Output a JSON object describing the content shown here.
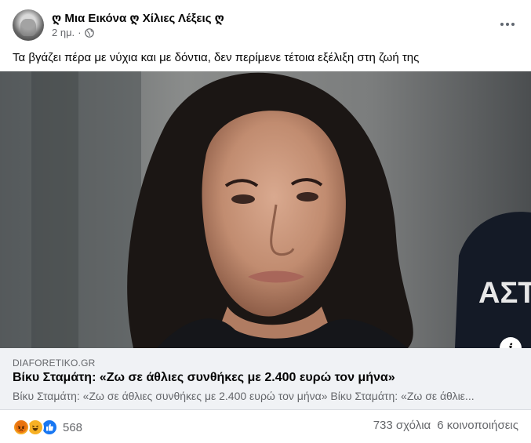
{
  "post": {
    "page_name": "ღ Μια Εικόνα ღ Χίλιες Λέξεις ღ",
    "time": "2 ημ.",
    "separator": "·",
    "privacy_icon": "globe-icon",
    "more_icon": "more-options-icon",
    "caption": "Τα βγάζει πέρα με νύχια και με δόντια, δεν περίμενε τέτοια εξέλιξη στη ζωή της"
  },
  "photo": {
    "overlay_text": "ΑΣΤ"
  },
  "link": {
    "domain": "DIAFORETIKO.GR",
    "title": "Βίκυ Σταμάτη: «Ζω σε άθλιες συνθήκες με 2.400 ευρώ τον μήνα»",
    "description": "Βίκυ Σταμάτη: «Ζω σε άθλιες συνθήκες με 2.400 ευρώ τον μήνα» Βίκυ Σταμάτη: «Ζω σε άθλιε...",
    "info_label": "i"
  },
  "footer": {
    "reactions": [
      "angry-icon",
      "haha-icon",
      "like-icon"
    ],
    "reaction_count": "568",
    "comments": "733 σχόλια",
    "shares": "6 κοινοποιήσεις"
  },
  "colors": {
    "secondary_text": "#65676b",
    "link_bg": "#f0f2f5",
    "like_blue": "#1877f2"
  }
}
